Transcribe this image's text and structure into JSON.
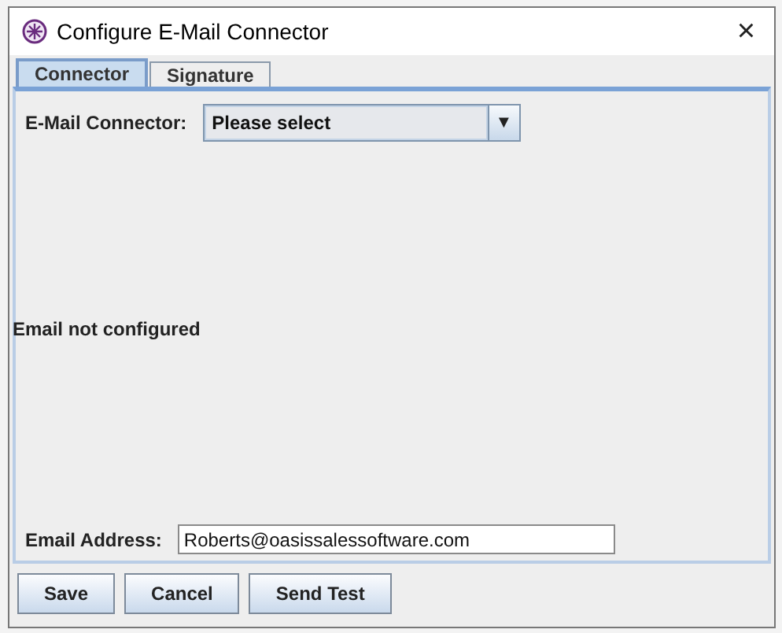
{
  "window": {
    "title": "Configure E-Mail Connector",
    "close": "×"
  },
  "tabs": [
    {
      "label": "Connector",
      "selected": true
    },
    {
      "label": "Signature",
      "selected": false
    }
  ],
  "connector": {
    "label": "E-Mail Connector:",
    "value": "Please select",
    "arrow": "▼"
  },
  "status": "Email not configured",
  "email": {
    "label": "Email Address:",
    "value": "Roberts@oasissalessoftware.com"
  },
  "buttons": [
    "Save",
    "Cancel",
    "Send Test"
  ]
}
